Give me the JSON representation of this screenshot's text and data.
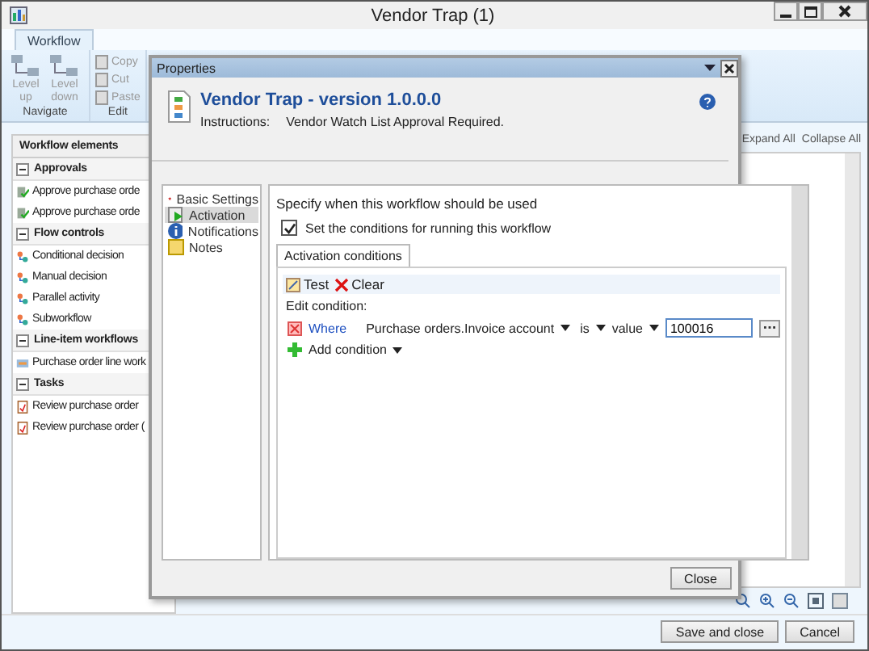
{
  "window": {
    "title": "Vendor Trap (1)"
  },
  "ribbon": {
    "tabs": [
      {
        "label": "Workflow",
        "selected": true
      }
    ],
    "groups": [
      {
        "label": "Navigate",
        "buttons": [
          {
            "label": "Level up",
            "kind": "large",
            "disabled": true
          },
          {
            "label": "Level down",
            "kind": "large",
            "disabled": true
          }
        ]
      },
      {
        "label": "Edit",
        "buttons": [
          {
            "label": "Copy",
            "kind": "small",
            "disabled": true
          },
          {
            "label": "Cut",
            "kind": "small",
            "disabled": true
          },
          {
            "label": "Paste",
            "kind": "small",
            "disabled": true
          }
        ]
      }
    ]
  },
  "elements_pane": {
    "title": "Workflow elements",
    "groups": [
      {
        "label": "Approvals",
        "expanded": true,
        "items": [
          {
            "label": "Approve purchase orde",
            "kind": "approval"
          },
          {
            "label": "Approve purchase orde",
            "kind": "approval"
          }
        ]
      },
      {
        "label": "Flow controls",
        "expanded": true,
        "items": [
          {
            "label": "Conditional decision",
            "kind": "decision"
          },
          {
            "label": "Manual decision",
            "kind": "manual"
          },
          {
            "label": "Parallel activity",
            "kind": "parallel"
          },
          {
            "label": "Subworkflow",
            "kind": "subworkflow"
          }
        ]
      },
      {
        "label": "Line-item workflows",
        "expanded": true,
        "items": [
          {
            "label": "Purchase order line work",
            "kind": "lineitem"
          }
        ]
      },
      {
        "label": "Tasks",
        "expanded": true,
        "items": [
          {
            "label": "Review purchase order",
            "kind": "task"
          },
          {
            "label": "Review purchase order (",
            "kind": "task"
          }
        ]
      }
    ]
  },
  "canvas": {
    "links": [
      "Expand All",
      "Collapse All"
    ]
  },
  "footer": {
    "buttons": [
      "Save and close",
      "Cancel"
    ]
  },
  "dialog": {
    "title": "Properties",
    "heading": "Vendor Trap - version 1.0.0.0",
    "instructions_label": "Instructions:",
    "instructions": "Vendor Watch List Approval Required.",
    "nav": [
      {
        "label": "Basic Settings",
        "kind": "star",
        "selected": false
      },
      {
        "label": "Activation",
        "kind": "activation",
        "selected": true
      },
      {
        "label": "Notifications",
        "kind": "info",
        "selected": false
      },
      {
        "label": "Notes",
        "kind": "notes",
        "selected": false
      }
    ],
    "prompt": "Specify when this workflow should be used",
    "checkbox": {
      "label": "Set the conditions for running this workflow",
      "checked": true
    },
    "tabs": [
      {
        "label": "Activation conditions",
        "selected": true
      }
    ],
    "toolbar": [
      "Test",
      "Clear"
    ],
    "edit_label": "Edit condition:",
    "condition": {
      "where": "Where",
      "field": "Purchase orders.Invoice account",
      "operator": "is",
      "type": "value",
      "value": "100016"
    },
    "add_condition": "Add condition",
    "close_button": "Close"
  }
}
